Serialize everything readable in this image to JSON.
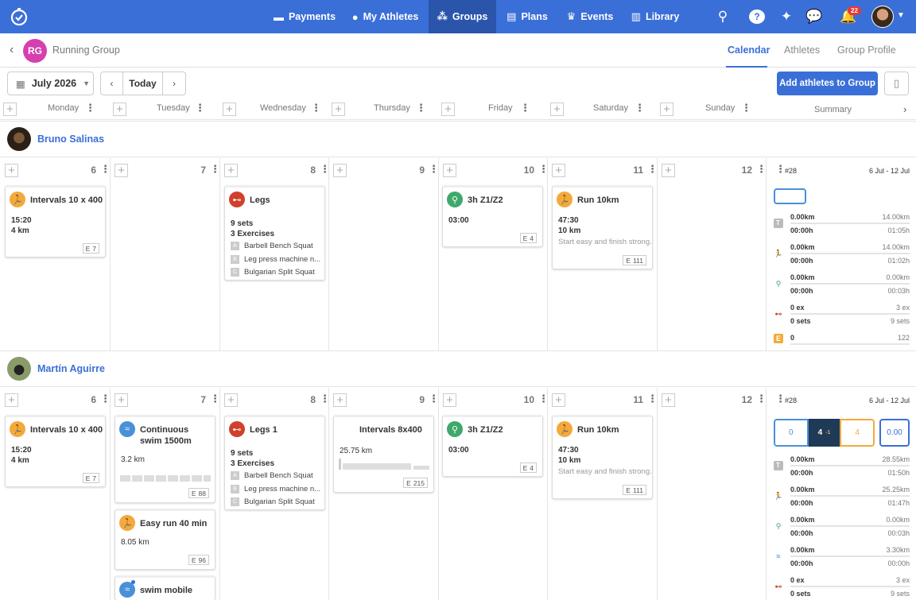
{
  "nav": {
    "items": [
      {
        "label": "Payments",
        "icon": "card-icon"
      },
      {
        "label": "My Athletes",
        "icon": "person-icon"
      },
      {
        "label": "Groups",
        "icon": "group-icon"
      },
      {
        "label": "Plans",
        "icon": "plan-icon"
      },
      {
        "label": "Events",
        "icon": "trophy-icon"
      },
      {
        "label": "Library",
        "icon": "book-icon"
      }
    ],
    "notif_count": "22"
  },
  "group": {
    "initials": "RG",
    "name": "Running Group"
  },
  "tabs": [
    "Calendar",
    "Athletes",
    "Group Profile"
  ],
  "toolbar": {
    "month": "July 2026",
    "today": "Today",
    "add": "Add athletes to Group"
  },
  "days": [
    "Monday",
    "Tuesday",
    "Wednesday",
    "Thursday",
    "Friday",
    "Saturday",
    "Sunday"
  ],
  "summary_label": "Summary",
  "athletes": [
    {
      "name": "Bruno Salinas",
      "dates": [
        "6",
        "7",
        "8",
        "9",
        "10",
        "11",
        "12"
      ],
      "week": "#28",
      "range": "6 Jul - 12 Jul",
      "summary": [
        [
          "0.00km",
          "14.00km",
          "00:00h",
          "01:05h"
        ],
        [
          "0.00km",
          "14.00km",
          "00:00h",
          "01:02h"
        ],
        [
          "0.00km",
          "0.00km",
          "00:00h",
          "00:03h"
        ],
        [
          "0 ex",
          "3 ex",
          "0 sets",
          "9 sets"
        ],
        [
          "0",
          "122"
        ]
      ]
    },
    {
      "name": "Martín Aguirre",
      "dates": [
        "6",
        "7",
        "8",
        "9",
        "10",
        "11",
        "12"
      ],
      "week": "#28",
      "range": "6 Jul - 12 Jul",
      "boxes": [
        "0",
        "4",
        "-1",
        "4",
        "0.00"
      ],
      "summary": [
        [
          "0.00km",
          "28.55km",
          "00:00h",
          "01:50h"
        ],
        [
          "0.00km",
          "25.25km",
          "00:00h",
          "01:47h"
        ],
        [
          "0.00km",
          "0.00km",
          "00:00h",
          "00:03h"
        ],
        [
          "0.00km",
          "3.30km",
          "00:00h",
          "00:00h"
        ],
        [
          "0 ex",
          "3 ex",
          "0 sets",
          "9 sets"
        ]
      ]
    }
  ],
  "summary_icon_letters": {
    "total": "T",
    "effort": "E"
  },
  "w1": {
    "mon": {
      "title": "Intervals 10 x 400",
      "l1": "15:20",
      "l2": "4 km",
      "e": "E",
      "n": "7"
    },
    "wed": {
      "title": "Legs",
      "l1": "9 sets",
      "l2": "3 Exercises",
      "ex": [
        [
          "A",
          "Barbell Bench Squat"
        ],
        [
          "B",
          "Leg press machine n..."
        ],
        [
          "C",
          "Bulgarian Split Squat"
        ]
      ]
    },
    "fri": {
      "title": "3h Z1/Z2",
      "l1": "03:00",
      "e": "E",
      "n": "4"
    },
    "sat": {
      "title": "Run 10km",
      "l1": "47:30",
      "l2": "10 km",
      "note": "Start easy and finish strong.",
      "e": "E",
      "n": "111"
    }
  },
  "w2": {
    "mon": {
      "title": "Intervals 10 x 400",
      "l1": "15:20",
      "l2": "4 km",
      "e": "E",
      "n": "7"
    },
    "tue1": {
      "title": "Continuous swim 1500m",
      "l1": "3.2 km",
      "e": "E",
      "n": "88"
    },
    "tue2": {
      "title": "Easy run 40 min",
      "l1": "8.05 km",
      "e": "E",
      "n": "96"
    },
    "tue3": {
      "title": "swim mobile"
    },
    "wed": {
      "title": "Legs 1",
      "l1": "9 sets",
      "l2": "3 Exercises",
      "ex": [
        [
          "A",
          "Barbell Bench Squat"
        ],
        [
          "B",
          "Leg press machine n..."
        ],
        [
          "C",
          "Bulgarian Split Squat"
        ]
      ]
    },
    "thu": {
      "title": "Intervals 8x400",
      "l1": "25.75 km",
      "e": "E",
      "n": "215"
    },
    "fri": {
      "title": "3h Z1/Z2",
      "l1": "03:00",
      "e": "E",
      "n": "4"
    },
    "sat": {
      "title": "Run 10km",
      "l1": "47:30",
      "l2": "10 km",
      "note": "Start easy and finish strong.",
      "e": "E",
      "n": "111"
    }
  }
}
